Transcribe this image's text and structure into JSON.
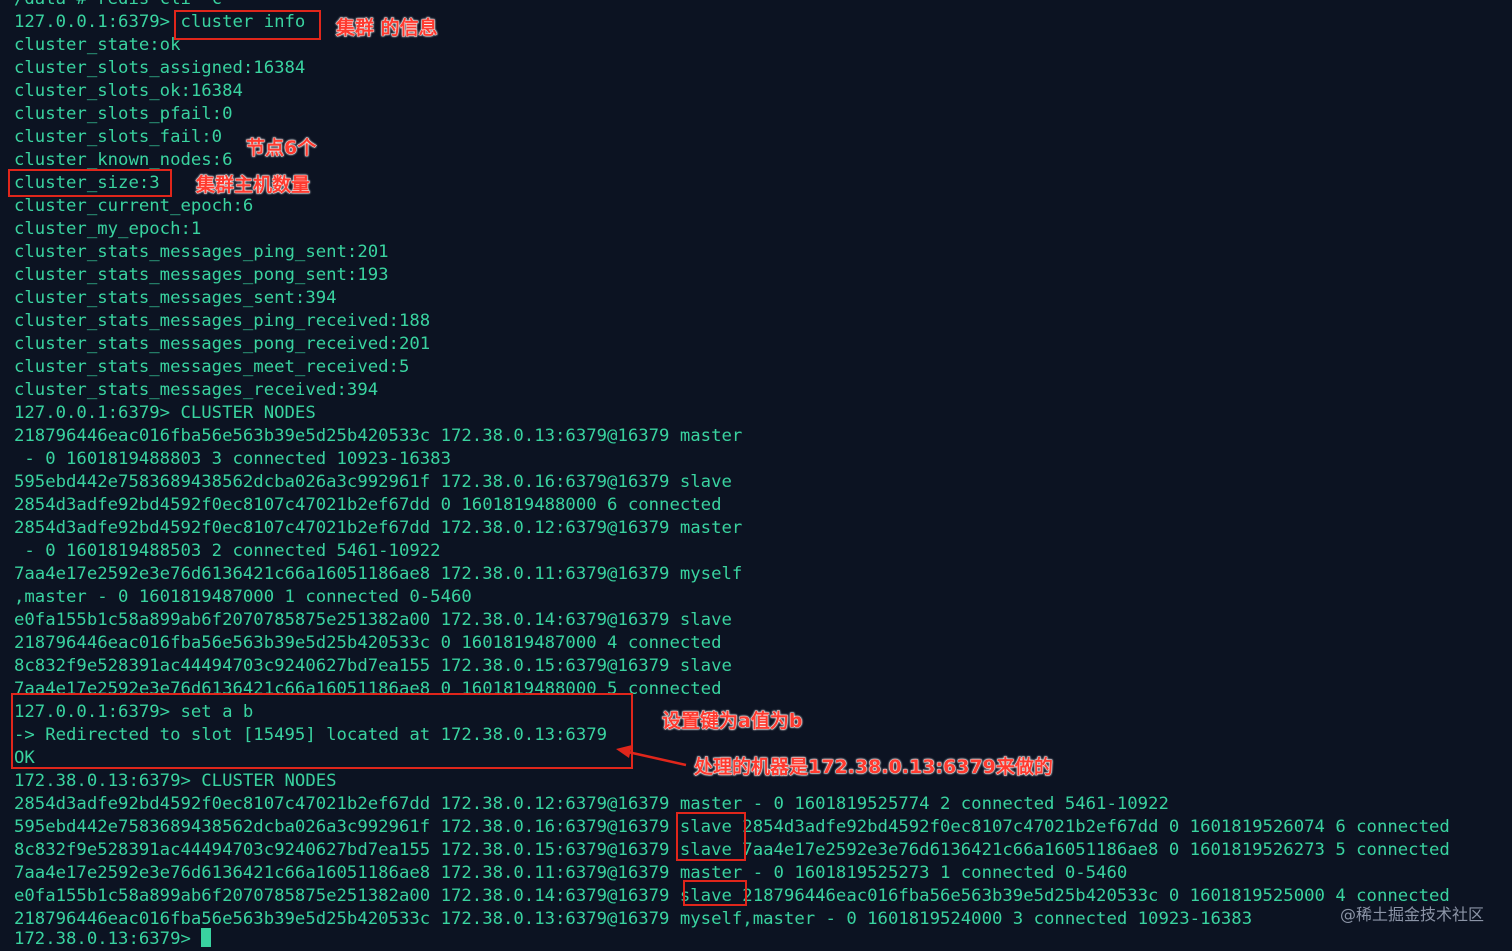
{
  "terminal": {
    "lines": [
      "/data # redis-cli -c",
      "127.0.0.1:6379> cluster info",
      "cluster_state:ok",
      "cluster_slots_assigned:16384",
      "cluster_slots_ok:16384",
      "cluster_slots_pfail:0",
      "cluster_slots_fail:0",
      "cluster_known_nodes:6",
      "cluster_size:3",
      "cluster_current_epoch:6",
      "cluster_my_epoch:1",
      "cluster_stats_messages_ping_sent:201",
      "cluster_stats_messages_pong_sent:193",
      "cluster_stats_messages_sent:394",
      "cluster_stats_messages_ping_received:188",
      "cluster_stats_messages_pong_received:201",
      "cluster_stats_messages_meet_received:5",
      "cluster_stats_messages_received:394",
      "127.0.0.1:6379> CLUSTER NODES",
      "218796446eac016fba56e563b39e5d25b420533c 172.38.0.13:6379@16379 master",
      " - 0 1601819488803 3 connected 10923-16383",
      "595ebd442e7583689438562dcba026a3c992961f 172.38.0.16:6379@16379 slave",
      "2854d3adfe92bd4592f0ec8107c47021b2ef67dd 0 1601819488000 6 connected",
      "2854d3adfe92bd4592f0ec8107c47021b2ef67dd 172.38.0.12:6379@16379 master",
      " - 0 1601819488503 2 connected 5461-10922",
      "7aa4e17e2592e3e76d6136421c66a16051186ae8 172.38.0.11:6379@16379 myself",
      ",master - 0 1601819487000 1 connected 0-5460",
      "e0fa155b1c58a899ab6f2070785875e251382a00 172.38.0.14:6379@16379 slave",
      "218796446eac016fba56e563b39e5d25b420533c 0 1601819487000 4 connected",
      "8c832f9e528391ac44494703c9240627bd7ea155 172.38.0.15:6379@16379 slave",
      "7aa4e17e2592e3e76d6136421c66a16051186ae8 0 1601819488000 5 connected",
      "127.0.0.1:6379> set a b",
      "-> Redirected to slot [15495] located at 172.38.0.13:6379",
      "OK",
      "172.38.0.13:6379> CLUSTER NODES",
      "2854d3adfe92bd4592f0ec8107c47021b2ef67dd 172.38.0.12:6379@16379 master - 0 1601819525774 2 connected 5461-10922",
      "595ebd442e7583689438562dcba026a3c992961f 172.38.0.16:6379@16379 slave 2854d3adfe92bd4592f0ec8107c47021b2ef67dd 0 1601819526074 6 connected",
      "8c832f9e528391ac44494703c9240627bd7ea155 172.38.0.15:6379@16379 slave 7aa4e17e2592e3e76d6136421c66a16051186ae8 0 1601819526273 5 connected",
      "7aa4e17e2592e3e76d6136421c66a16051186ae8 172.38.0.11:6379@16379 master - 0 1601819525273 1 connected 0-5460",
      "e0fa155b1c58a899ab6f2070785875e251382a00 172.38.0.14:6379@16379 slave 218796446eac016fba56e563b39e5d25b420533c 0 1601819525000 4 connected",
      "218796446eac016fba56e563b39e5d25b420533c 172.38.0.13:6379@16379 myself,master - 0 1601819524000 3 connected 10923-16383",
      "172.38.0.13:6379> "
    ]
  },
  "annotations": {
    "cluster_info": "集群 的信息",
    "nodes_count": "节点6个",
    "master_count": "集群主机数量",
    "set_key": "设置键为a值为b",
    "handled_by": "处理的机器是172.38.0.13:6379来做的"
  },
  "watermark": "@稀土掘金技术社区",
  "colors": {
    "background": "#0c1322",
    "terminal_text": "#39d3a0",
    "annotation": "#ff3b30",
    "highlight_box": "#e0261b"
  }
}
